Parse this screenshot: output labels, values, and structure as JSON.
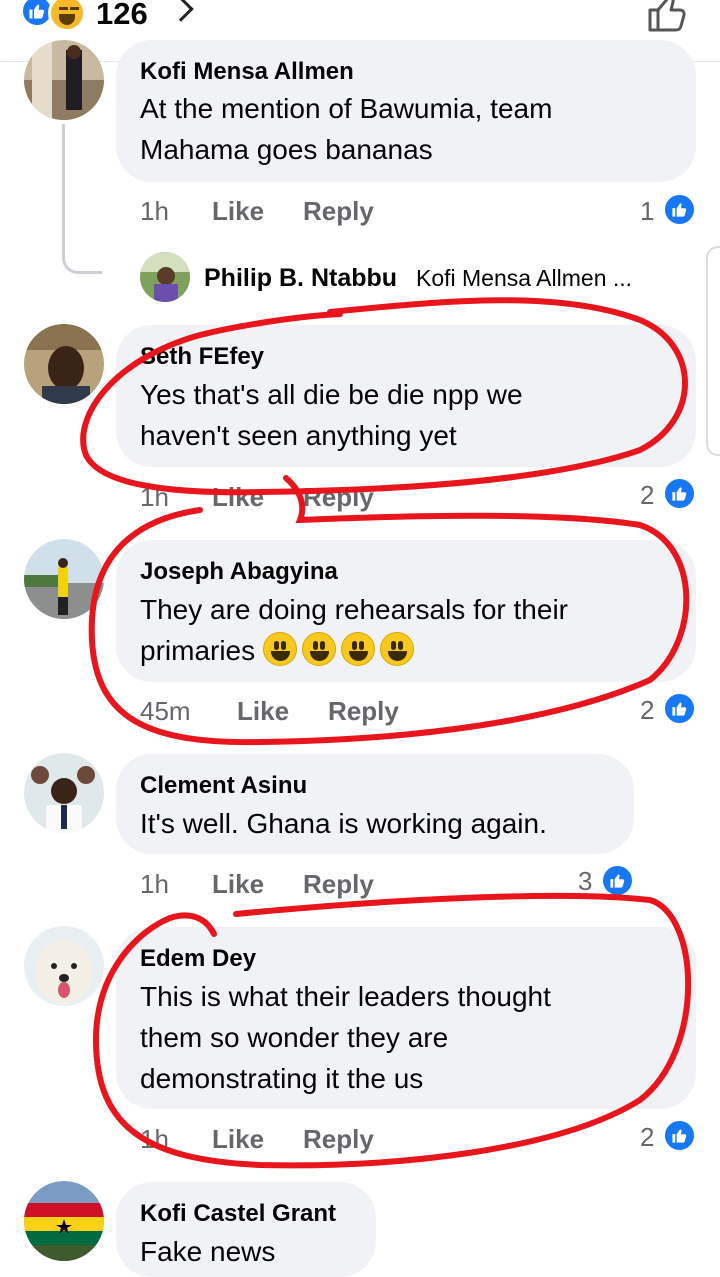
{
  "header": {
    "reaction_count": "126",
    "icons": [
      "like-icon",
      "haha-icon",
      "chevron-right-icon",
      "thumbs-up-outline-icon"
    ]
  },
  "comments": [
    {
      "name": "Kofi Mensa Allmen",
      "text": "At the mention of Bawumia, team\nMahama goes bananas",
      "time": "1h",
      "like": "Like",
      "reply": "Reply",
      "reactions": "1",
      "reply_preview": {
        "name": "Philip B. Ntabbu",
        "text": "Kofi Mensa Allmen ..."
      }
    },
    {
      "name": "Seth FEfey",
      "text": "Yes that's all die be die npp we\nhaven't seen anything yet",
      "time": "1h",
      "like": "Like",
      "reply": "Reply",
      "reactions": "2"
    },
    {
      "name": "Joseph Abagyina",
      "text": "They are doing rehearsals for their\nprimaries",
      "time": "45m",
      "like": "Like",
      "reply": "Reply",
      "reactions": "2",
      "emoji_count": 4
    },
    {
      "name": "Clement Asinu",
      "text": "It's well. Ghana is working again.",
      "time": "1h",
      "like": "Like",
      "reply": "Reply",
      "reactions": "3"
    },
    {
      "name": "Edem Dey",
      "text": "This is what their leaders thought\nthem so wonder they are\ndemonstrating it the us",
      "time": "1h",
      "like": "Like",
      "reply": "Reply",
      "reactions": "2"
    },
    {
      "name": "Kofi Castel Grant",
      "text": "Fake news"
    }
  ],
  "colors": {
    "accent": "#1877f2",
    "annotation": "#e8161c",
    "bubble": "#f0f2f5",
    "meta": "#65676b"
  }
}
